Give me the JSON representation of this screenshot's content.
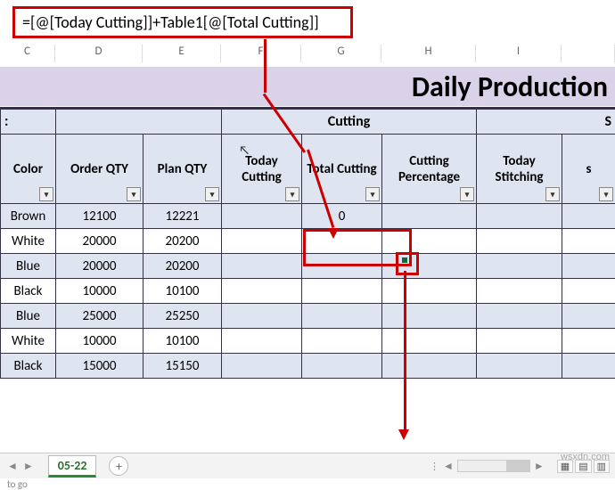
{
  "formula": "=[@[Today Cutting]]+Table1[@[Total Cutting]]",
  "columns": [
    "C",
    "D",
    "E",
    "F",
    "G",
    "H",
    "I"
  ],
  "title": "Daily Production",
  "section_left_first": ":",
  "section_cutting": "Cutting",
  "section_stitch": "S",
  "headers": {
    "c": "Color",
    "d": "Order QTY",
    "e": "Plan QTY",
    "f": "Today Cutting",
    "g": "Total Cutting",
    "h": "Cutting Percentage",
    "i": "Today Stitching",
    "j": "s"
  },
  "rows": [
    {
      "c": "Brown",
      "d": "12100",
      "e": "12221",
      "f": "",
      "g": "0",
      "h": "",
      "i": "",
      "j": ""
    },
    {
      "c": "White",
      "d": "20000",
      "e": "20200",
      "f": "",
      "g": "",
      "h": "",
      "i": "",
      "j": ""
    },
    {
      "c": "Blue",
      "d": "20000",
      "e": "20200",
      "f": "",
      "g": "",
      "h": "",
      "i": "",
      "j": ""
    },
    {
      "c": "Black",
      "d": "10000",
      "e": "10100",
      "f": "",
      "g": "",
      "h": "",
      "i": "",
      "j": ""
    },
    {
      "c": "Blue",
      "d": "25000",
      "e": "25250",
      "f": "",
      "g": "",
      "h": "",
      "i": "",
      "j": ""
    },
    {
      "c": "White",
      "d": "10000",
      "e": "10100",
      "f": "",
      "g": "",
      "h": "",
      "i": "",
      "j": ""
    },
    {
      "c": "Black",
      "d": "15000",
      "e": "15150",
      "f": "",
      "g": "",
      "h": "",
      "i": "",
      "j": ""
    }
  ],
  "sheet_tab": "05-22",
  "status": "to go",
  "watermark": "wsxdn.com"
}
